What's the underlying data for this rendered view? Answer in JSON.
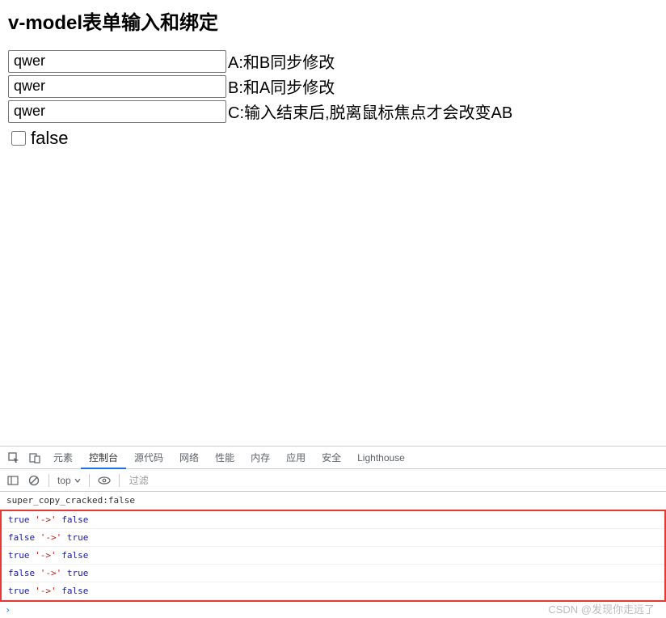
{
  "page": {
    "title": "v-model表单输入和绑定"
  },
  "inputs": {
    "a": {
      "value": "qwer",
      "label": "A:和B同步修改"
    },
    "b": {
      "value": "qwer",
      "label": "B:和A同步修改"
    },
    "c": {
      "value": "qwer",
      "label": "C:输入结束后,脱离鼠标焦点才会改变AB"
    }
  },
  "checkbox": {
    "checked": false,
    "label": "false"
  },
  "devtools": {
    "tabs": {
      "elements": "元素",
      "console": "控制台",
      "sources": "源代码",
      "network": "网络",
      "performance": "性能",
      "memory": "内存",
      "application": "应用",
      "security": "安全",
      "lighthouse": "Lighthouse"
    },
    "toolbar": {
      "context": "top",
      "filter_placeholder": "过滤"
    },
    "console": {
      "first_line": "super_copy_cracked:false",
      "lines": [
        {
          "a": "true",
          "sep": " '->' ",
          "b": "false"
        },
        {
          "a": "false",
          "sep": " '->' ",
          "b": "true"
        },
        {
          "a": "true",
          "sep": " '->' ",
          "b": "false"
        },
        {
          "a": "false",
          "sep": " '->' ",
          "b": "true"
        },
        {
          "a": "true",
          "sep": " '->' ",
          "b": "false"
        }
      ]
    }
  },
  "watermark": "CSDN @发现你走远了"
}
